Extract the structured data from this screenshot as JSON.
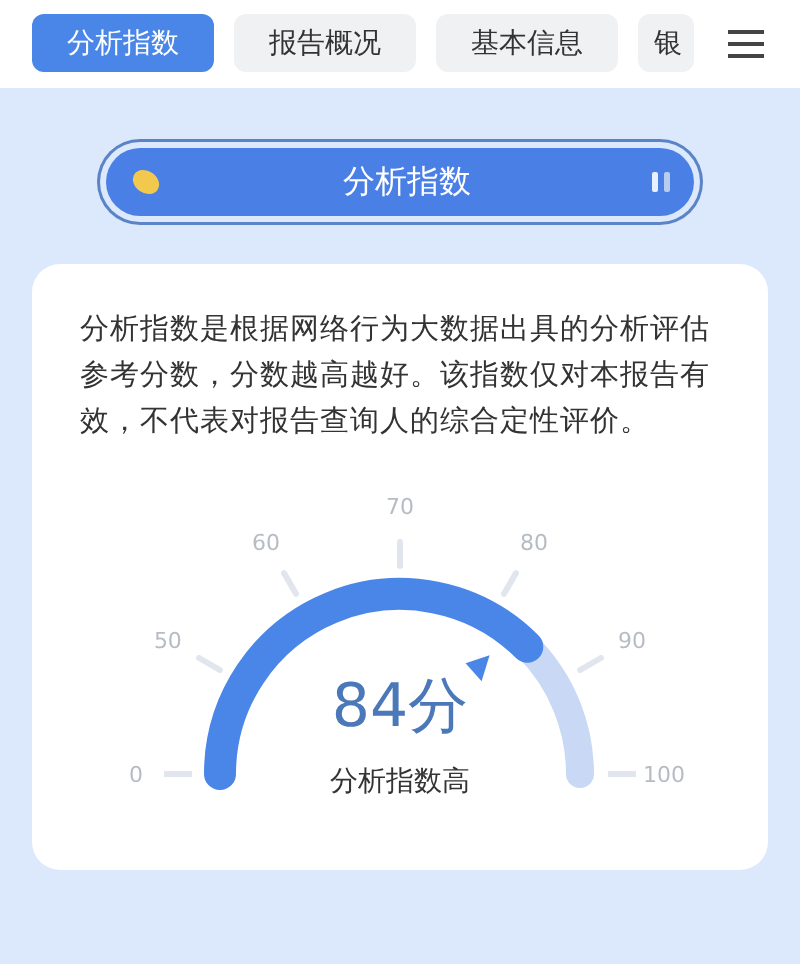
{
  "tabs": [
    {
      "label": "分析指数",
      "selected": true
    },
    {
      "label": "报告概况",
      "selected": false
    },
    {
      "label": "基本信息",
      "selected": false
    },
    {
      "label": "银",
      "selected": false
    }
  ],
  "banner": {
    "title": "分析指数"
  },
  "card": {
    "description": "分析指数是根据网络行为大数据出具的分析评估参考分数，分数越高越好。该指数仅对本报告有效，不代表对报告查询人的综合定性评价。",
    "gauge": {
      "scale_labels": [
        "0",
        "50",
        "60",
        "70",
        "80",
        "90",
        "100"
      ],
      "score": "84分",
      "verdict": "分析指数高"
    }
  }
}
